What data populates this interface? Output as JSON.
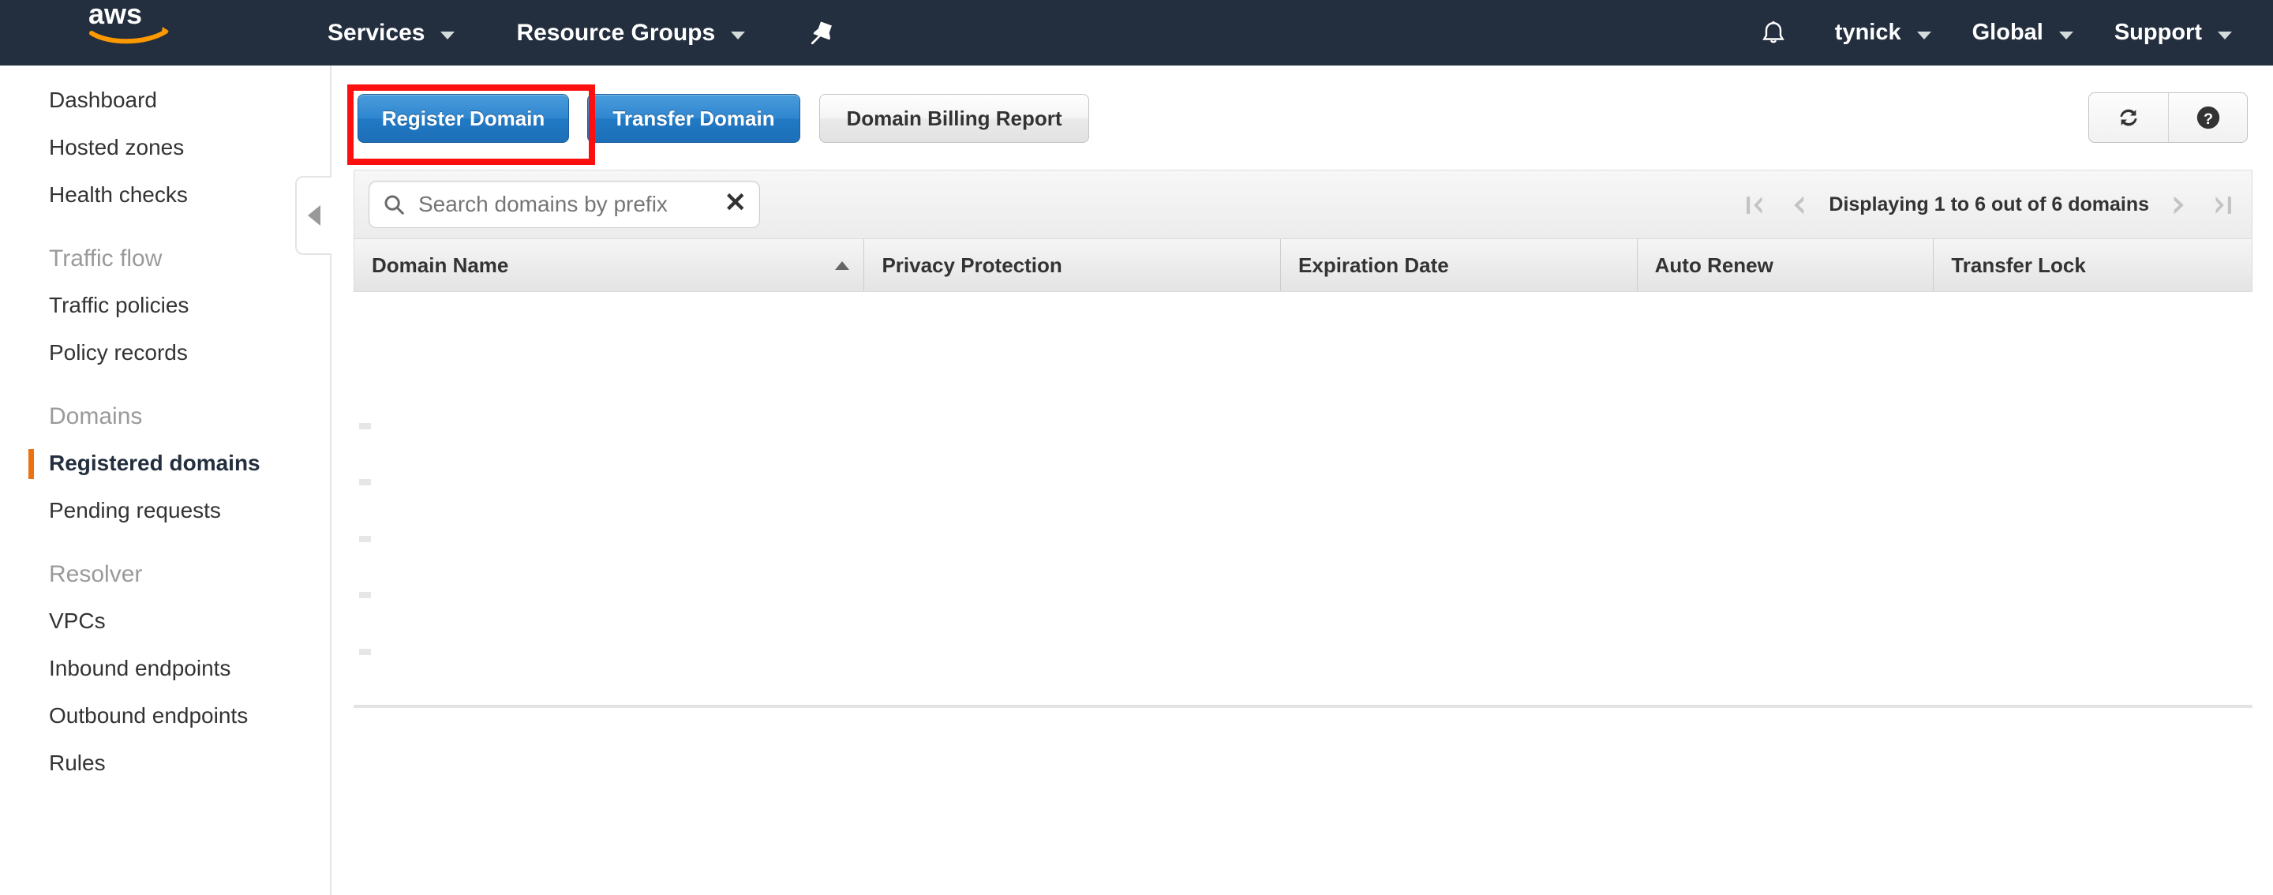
{
  "topnav": {
    "logo_alt": "aws",
    "services": "Services",
    "resource_groups": "Resource Groups",
    "pin_icon": "pin-icon",
    "bell_icon": "bell-icon",
    "user": "tynick",
    "region": "Global",
    "support": "Support"
  },
  "sidebar": {
    "items": [
      {
        "label": "Dashboard",
        "type": "link",
        "active": false
      },
      {
        "label": "Hosted zones",
        "type": "link",
        "active": false
      },
      {
        "label": "Health checks",
        "type": "link",
        "active": false
      },
      {
        "label": "Traffic flow",
        "type": "heading"
      },
      {
        "label": "Traffic policies",
        "type": "link",
        "active": false
      },
      {
        "label": "Policy records",
        "type": "link",
        "active": false
      },
      {
        "label": "Domains",
        "type": "heading"
      },
      {
        "label": "Registered domains",
        "type": "link",
        "active": true
      },
      {
        "label": "Pending requests",
        "type": "link",
        "active": false
      },
      {
        "label": "Resolver",
        "type": "heading"
      },
      {
        "label": "VPCs",
        "type": "link",
        "active": false
      },
      {
        "label": "Inbound endpoints",
        "type": "link",
        "active": false
      },
      {
        "label": "Outbound endpoints",
        "type": "link",
        "active": false
      },
      {
        "label": "Rules",
        "type": "link",
        "active": false
      }
    ],
    "collapse_icon": "chevron-left-icon"
  },
  "toolbar": {
    "register_domain": "Register Domain",
    "transfer_domain": "Transfer Domain",
    "domain_billing_report": "Domain Billing Report",
    "refresh_icon": "refresh-icon",
    "help_icon": "help-circle-icon",
    "highlight_color": "#fb0f0f",
    "primary_button_color": "#2179c4"
  },
  "search": {
    "placeholder": "Search domains by prefix",
    "value": "",
    "search_icon": "search-icon",
    "clear_icon": "close-icon",
    "clear_label": "✕"
  },
  "pagination": {
    "status": "Displaying 1 to 6 out of 6 domains",
    "first_icon": "first-page-icon",
    "prev_icon": "previous-page-icon",
    "next_icon": "next-page-icon",
    "last_icon": "last-page-icon"
  },
  "table": {
    "columns": [
      {
        "label": "Domain Name",
        "sorted": "asc"
      },
      {
        "label": "Privacy Protection",
        "sorted": "none"
      },
      {
        "label": "Expiration Date",
        "sorted": "none"
      },
      {
        "label": "Auto Renew",
        "sorted": "none"
      },
      {
        "label": "Transfer Lock",
        "sorted": "none"
      }
    ],
    "rows": [],
    "row_count": 6
  }
}
